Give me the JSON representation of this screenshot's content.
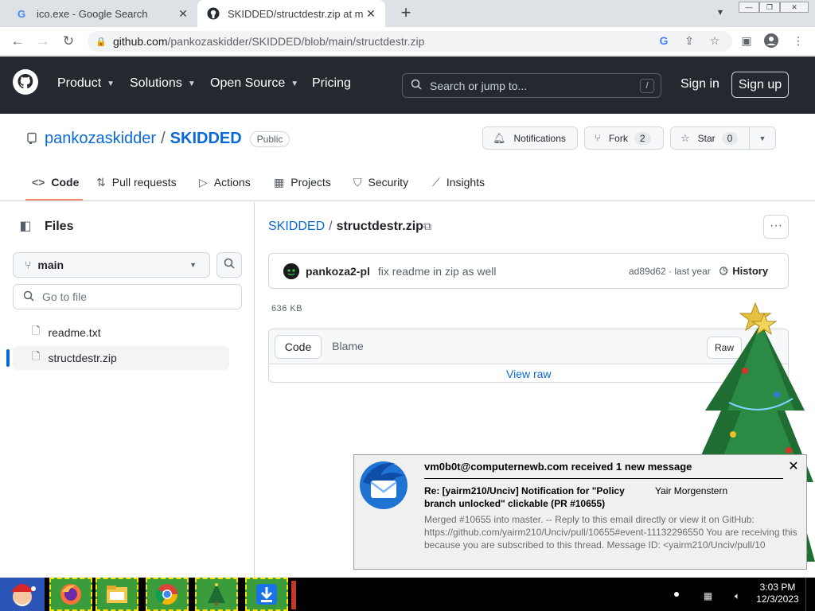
{
  "browser": {
    "tabs": [
      {
        "title": "ico.exe - Google Search",
        "active": false,
        "favicon": "google-icon"
      },
      {
        "title": "SKIDDED/structdestr.zip at main",
        "active": true,
        "favicon": "github-icon"
      }
    ],
    "new_tab": "+",
    "url_host": "github.com",
    "url_path": "/pankozaskidder/SKIDDED/blob/main/structdestr.zip"
  },
  "github_header": {
    "nav": [
      "Product",
      "Solutions",
      "Open Source",
      "Pricing"
    ],
    "search_placeholder": "Search or jump to...",
    "search_key": "/",
    "sign_in": "Sign in",
    "sign_up": "Sign up"
  },
  "repo": {
    "owner": "pankozaskidder",
    "separator": "/",
    "name": "SKIDDED",
    "visibility": "Public",
    "notifications_label": "Notifications",
    "fork_label": "Fork",
    "fork_count": "2",
    "star_label": "Star",
    "star_count": "0",
    "tabs": [
      "Code",
      "Pull requests",
      "Actions",
      "Projects",
      "Security",
      "Insights"
    ],
    "active_tab": "Code"
  },
  "file_tree": {
    "title": "Files",
    "branch": "main",
    "goto_placeholder": "Go to file",
    "files": [
      "readme.txt",
      "structdestr.zip"
    ],
    "selected": "structdestr.zip"
  },
  "file_view": {
    "breadcrumb_repo": "SKIDDED",
    "breadcrumb_sep": "/",
    "file_name": "structdestr.zip",
    "commit_author": "pankoza2-pl",
    "commit_message": "fix readme in zip as well",
    "commit_meta": "ad89d62 · last year",
    "history_label": "History",
    "size": "636 KB",
    "mode_code": "Code",
    "mode_blame": "Blame",
    "raw_label": "Raw",
    "view_raw": "View raw"
  },
  "notification": {
    "header": "vm0b0t@computernewb.com received 1 new message",
    "subject": "Re: [yairm210/Unciv] Notification for \"Policy branch unlocked\" clickable (PR #10655)",
    "from": "Yair Morgenstern",
    "body": "Merged #10655 into master. -- Reply to this email directly or view it on GitHub: https://github.com/yairm210/Unciv/pull/10655#event-11132296550 You are receiving this because you are subscribed to this thread. Message ID: <yairm210/Unciv/pull/10",
    "close": "✕"
  },
  "taskbar": {
    "time": "3:03 PM",
    "date": "12/3/2023"
  },
  "colors": {
    "github_header_bg": "#24292f",
    "link_blue": "#0969da",
    "tab_underline": "#fd8c73",
    "taskbar_app_bg": "#3a9c3a"
  }
}
